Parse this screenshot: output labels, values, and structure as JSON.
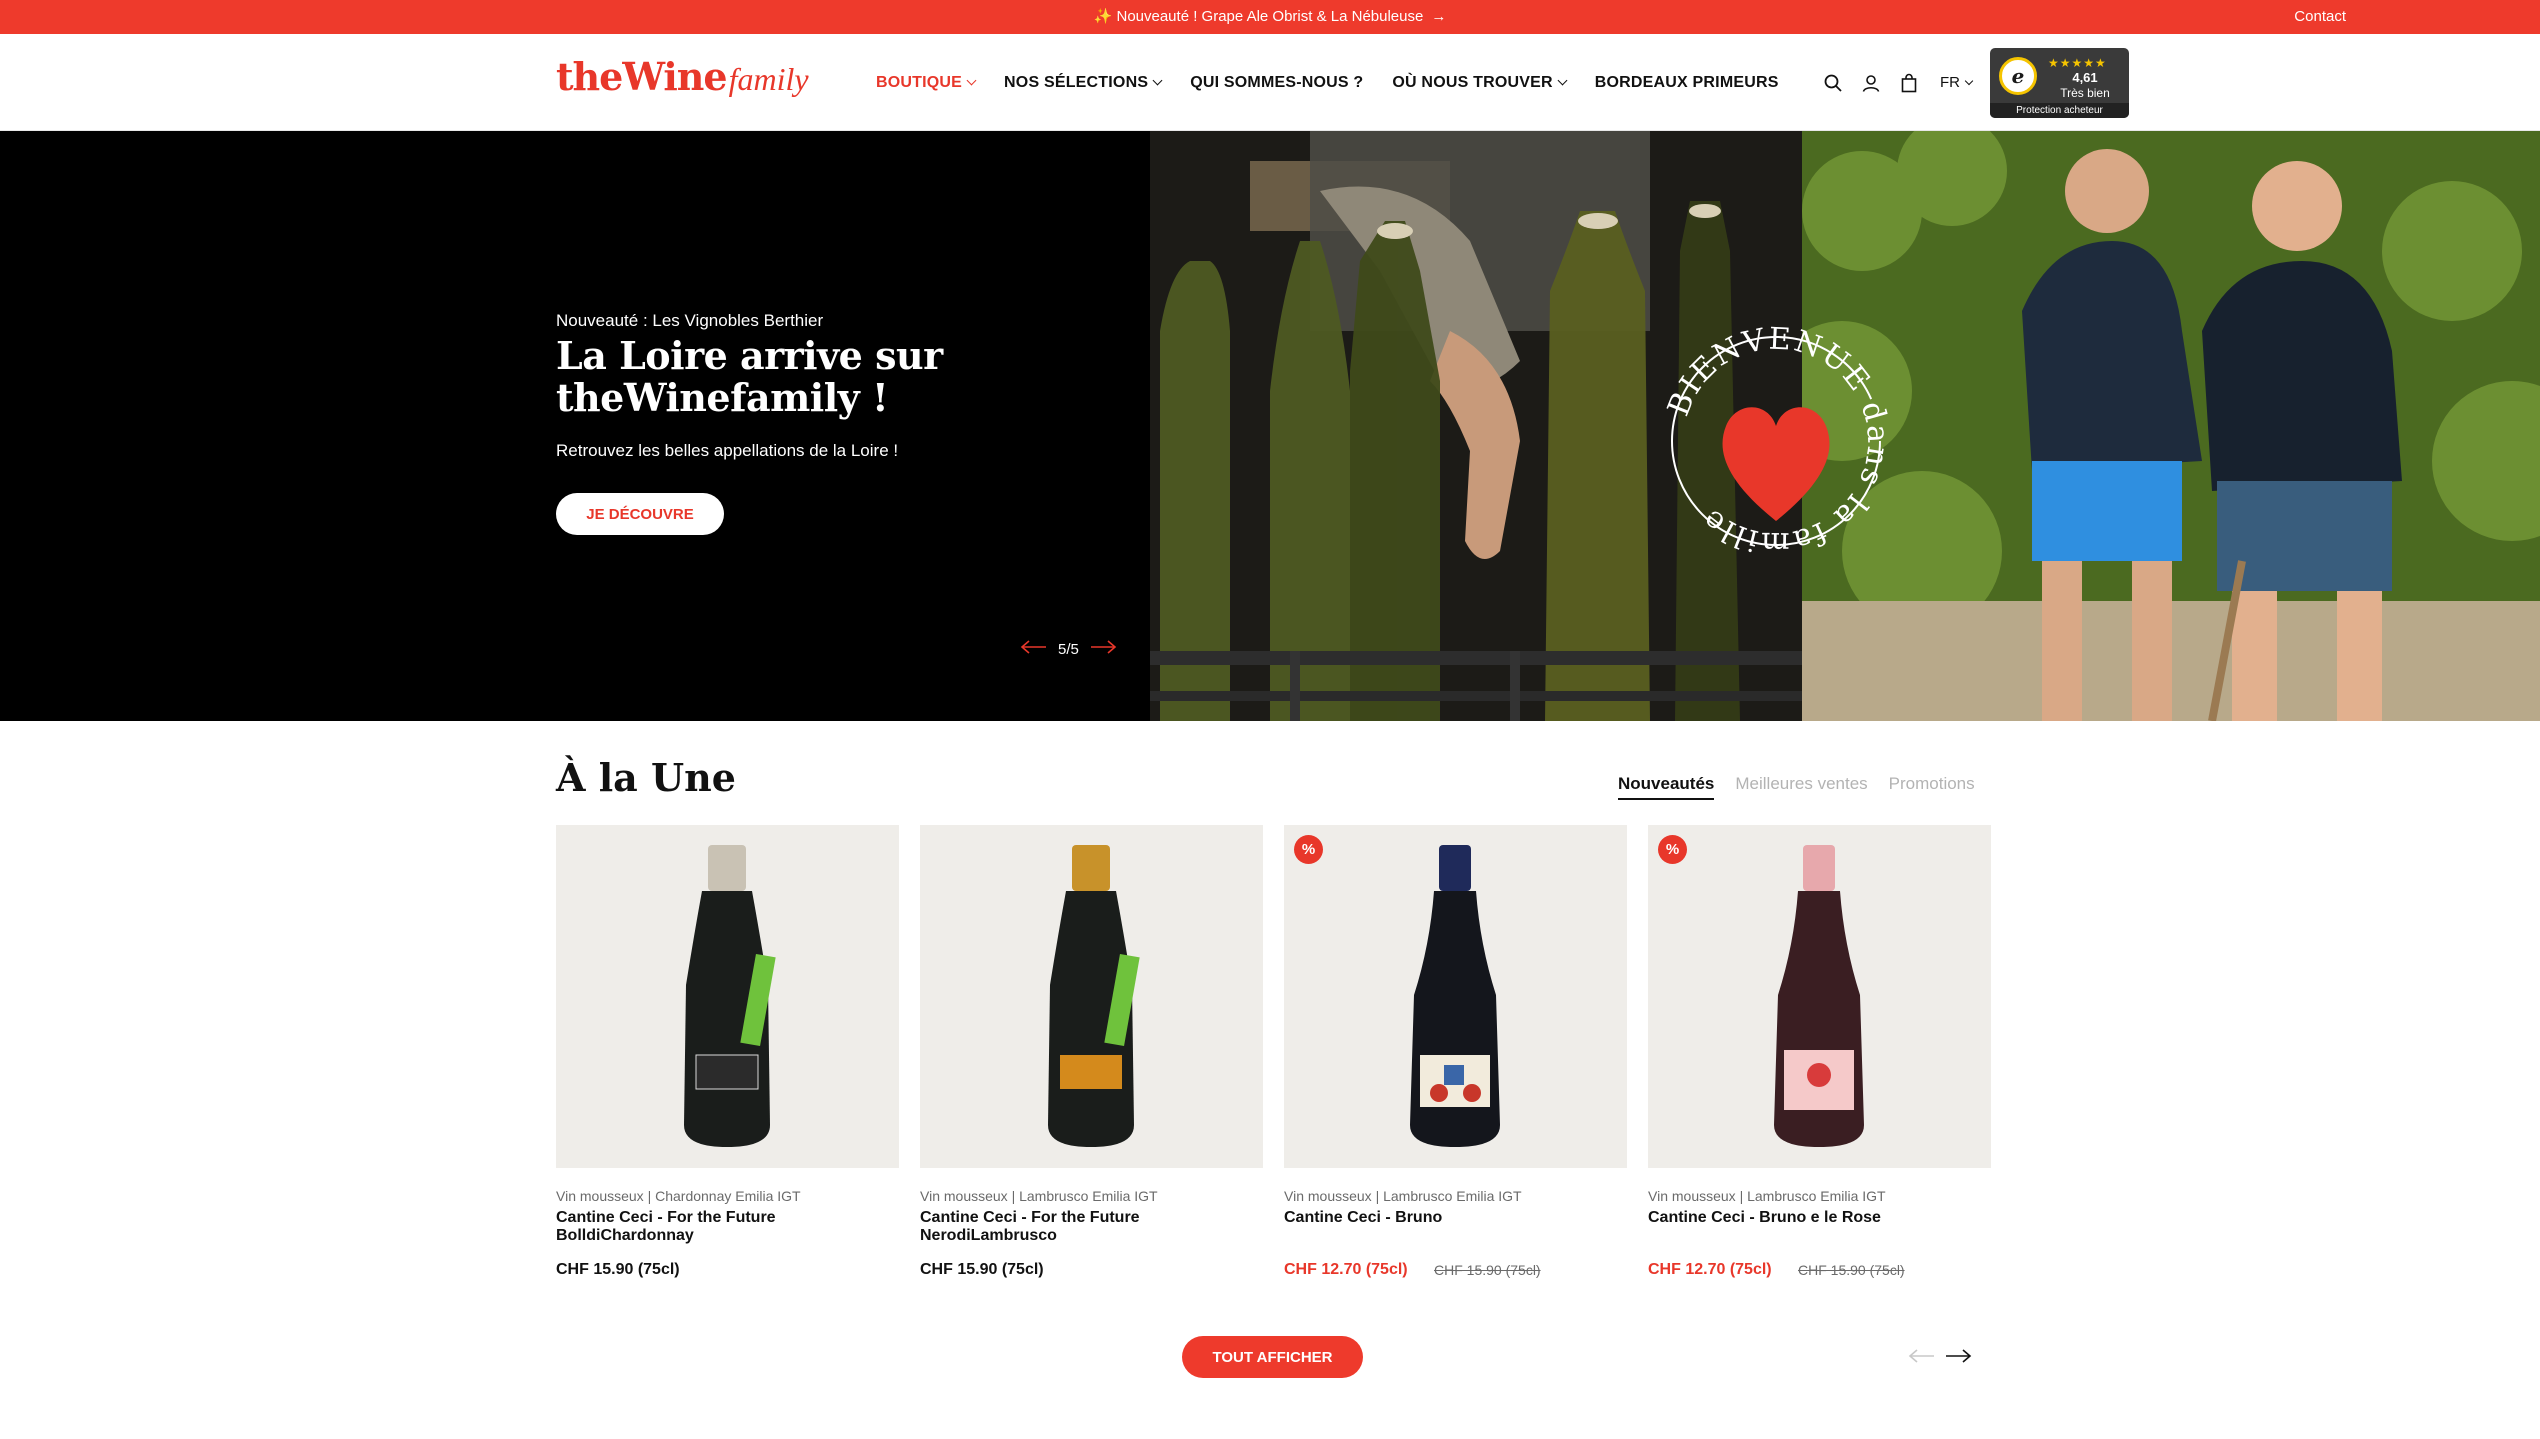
{
  "announcement": {
    "text": "✨ Nouveauté ! Grape Ale Obrist & La Nébuleuse",
    "arrow": "→",
    "contact": "Contact"
  },
  "brand": {
    "logo_bold": "theWine",
    "logo_script": "family",
    "color": "#e8372a"
  },
  "nav": {
    "items": [
      {
        "label": "BOUTIQUE",
        "active": true,
        "has_dropdown": true
      },
      {
        "label": "NOS SÉLECTIONS",
        "active": false,
        "has_dropdown": true
      },
      {
        "label": "QUI SOMMES-NOUS ?",
        "active": false,
        "has_dropdown": false
      },
      {
        "label": "OÙ NOUS TROUVER",
        "active": false,
        "has_dropdown": true
      },
      {
        "label": "BORDEAUX PRIMEURS",
        "active": false,
        "has_dropdown": false
      }
    ]
  },
  "header_icons": {
    "search": "search-icon",
    "account": "user-icon",
    "cart": "shopping-bag-icon",
    "language": "FR"
  },
  "trusted_shops": {
    "stars": "★★★★★",
    "rating": "4,61",
    "label": "Très bien",
    "protection": "Protection acheteur",
    "seal_letter": "e"
  },
  "hero": {
    "eyebrow": "Nouveauté : Les Vignobles Berthier",
    "title": "La Loire arrive sur theWinefamily !",
    "subtitle": "Retrouvez les belles appellations de la Loire !",
    "cta": "JE DÉCOUVRE",
    "counter": "5/5",
    "stamp_text": "BIENVENUE dans la famille",
    "accent": "#e8372a"
  },
  "featured": {
    "title": "À la Une",
    "tabs": [
      {
        "label": "Nouveautés",
        "active": true
      },
      {
        "label": "Meilleures ventes",
        "active": false
      },
      {
        "label": "Promotions",
        "active": false
      }
    ],
    "products": [
      {
        "category": "Vin mousseux | Chardonnay Emilia IGT",
        "name": "Cantine Ceci - For the Future BolldiChardonnay",
        "price": "CHF 15.90 (75cl)",
        "old_price": "",
        "on_sale": false
      },
      {
        "category": "Vin mousseux | Lambrusco Emilia IGT",
        "name": "Cantine Ceci - For the Future NerodiLambrusco",
        "price": "CHF 15.90 (75cl)",
        "old_price": "",
        "on_sale": false
      },
      {
        "category": "Vin mousseux | Lambrusco Emilia IGT",
        "name": "Cantine Ceci - Bruno",
        "price": "CHF 12.70 (75cl)",
        "old_price": "CHF 15.90 (75cl)",
        "on_sale": true
      },
      {
        "category": "Vin mousseux | Lambrusco Emilia IGT",
        "name": "Cantine Ceci - Bruno e le Rose",
        "price": "CHF 12.70 (75cl)",
        "old_price": "CHF 15.90 (75cl)",
        "on_sale": true
      }
    ],
    "sale_badge": "%",
    "show_all": "TOUT AFFICHER"
  }
}
